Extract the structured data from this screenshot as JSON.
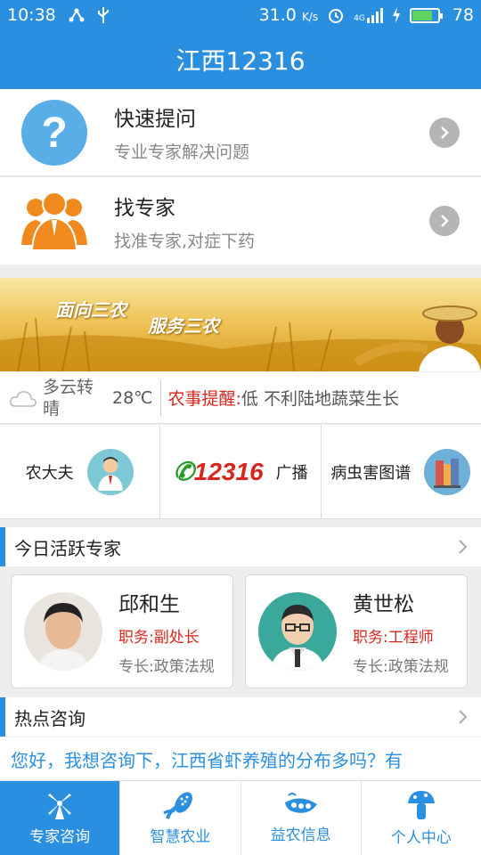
{
  "status_bar": {
    "time": "10:38",
    "speed": "31.0",
    "speed_unit": "K/s",
    "network": "4G",
    "battery": "78",
    "battery_level": 0.78
  },
  "app": {
    "title": "江西12316"
  },
  "menu": [
    {
      "title": "快速提问",
      "subtitle": "专业专家解决问题",
      "icon": "question-icon"
    },
    {
      "title": "找专家",
      "subtitle": "找准专家,对症下药",
      "icon": "experts-icon"
    }
  ],
  "banner": {
    "line1": "面向三农",
    "line2": "服务三农"
  },
  "weather": {
    "desc": "多云转晴",
    "temp": "28℃"
  },
  "reminder": {
    "label": "农事提醒:",
    "text": "低 不利陆地蔬菜生长"
  },
  "quick_links": [
    {
      "label": "农大夫",
      "icon": "doctor-icon"
    },
    {
      "label": "广播",
      "logo": "12316",
      "icon": "phone-logo-icon"
    },
    {
      "label": "病虫害图谱",
      "icon": "books-icon"
    }
  ],
  "active_experts": {
    "title": "今日活跃专家",
    "experts": [
      {
        "name": "邱和生",
        "role": "职务:副处长",
        "specialty": "专长:政策法规"
      },
      {
        "name": "黄世松",
        "role": "职务:工程师",
        "specialty": "专长:政策法规"
      }
    ]
  },
  "hot": {
    "title": "热点咨询",
    "question": "您好，我想咨询下，江西省虾养殖的分布多吗？有"
  },
  "bottom_nav": [
    {
      "label": "专家咨询",
      "active": true,
      "icon": "windmill-icon"
    },
    {
      "label": "智慧农业",
      "active": false,
      "icon": "corn-icon"
    },
    {
      "label": "益农信息",
      "active": false,
      "icon": "peas-icon"
    },
    {
      "label": "个人中心",
      "active": false,
      "icon": "mushroom-icon"
    }
  ],
  "colors": {
    "primary": "#2b8fe0",
    "alert": "#d7261e",
    "orange": "#f08a1e"
  }
}
